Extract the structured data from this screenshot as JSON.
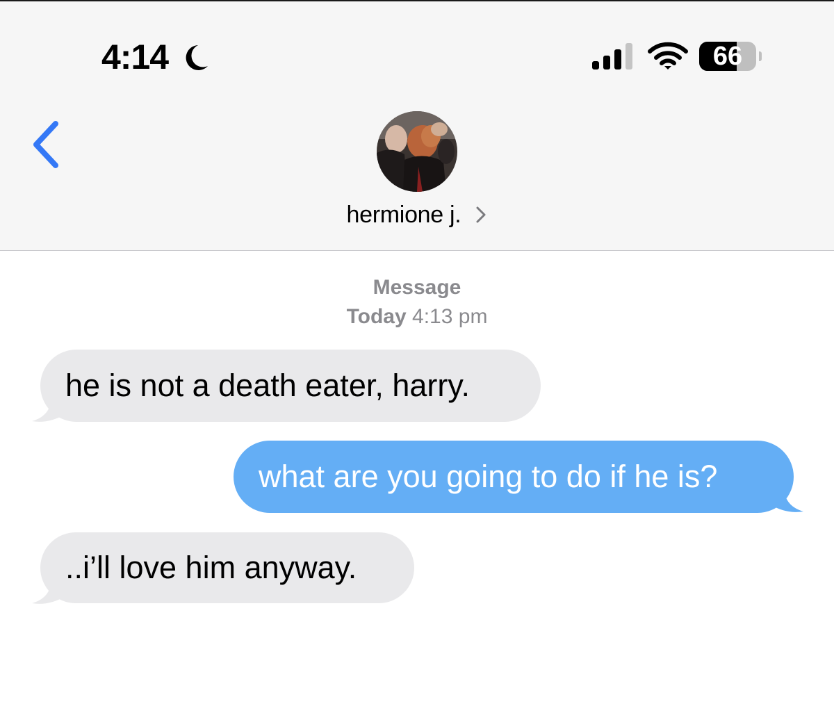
{
  "status_bar": {
    "time": "4:14",
    "focus_icon": "moon-icon",
    "signal_icon": "cellular-signal-icon",
    "wifi_icon": "wifi-icon",
    "battery_level": 66,
    "battery_label": "66"
  },
  "header": {
    "back_icon": "chevron-left-icon",
    "avatar": "contact-photo",
    "contact_name": "hermione j.",
    "contact_chevron_icon": "chevron-right-icon"
  },
  "thread": {
    "service": "Message",
    "day": "Today",
    "time": "4:13 pm",
    "messages": [
      {
        "direction": "incoming",
        "text": "he is not a death eater, harry."
      },
      {
        "direction": "outgoing",
        "text": "what are you going to do if he is?"
      },
      {
        "direction": "incoming",
        "text": "..i’ll love him anyway."
      }
    ]
  },
  "colors": {
    "incoming_bubble": "#e9e9eb",
    "outgoing_bubble": "#64aef5",
    "accent": "#3478f6",
    "meta_text": "#8a8a8e",
    "header_bg": "#f6f6f6"
  }
}
